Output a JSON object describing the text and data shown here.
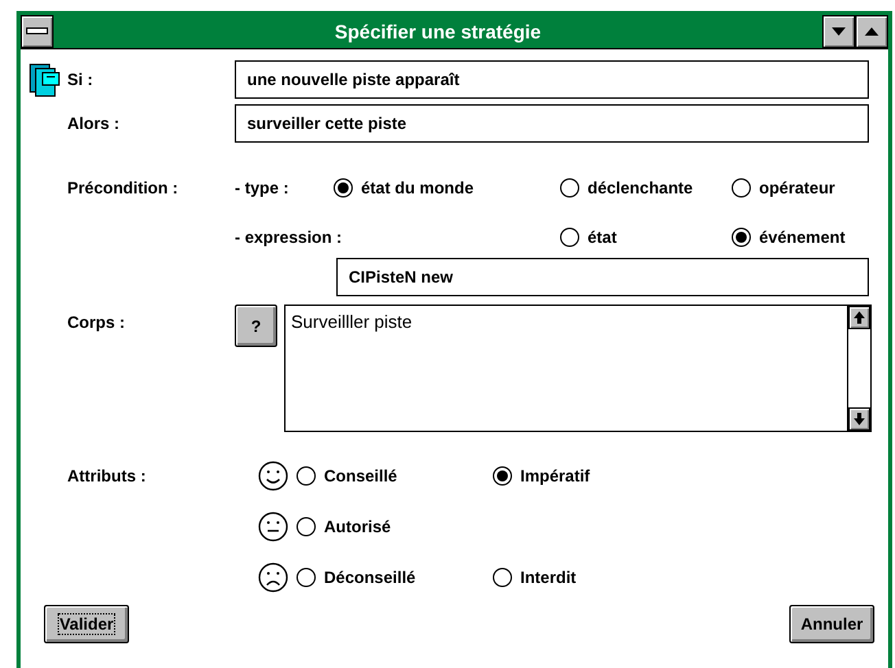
{
  "window": {
    "title": "Spécifier une stratégie"
  },
  "fields": [
    {
      "label": "Si :",
      "value": "une nouvelle piste apparaît"
    },
    {
      "label": "Alors :",
      "value": "surveiller cette piste"
    }
  ],
  "precondition": {
    "label": "Précondition :",
    "type": {
      "label": "- type :",
      "options": [
        {
          "label": "état du monde",
          "selected": true
        },
        {
          "label": "déclenchante",
          "selected": false
        },
        {
          "label": "opérateur",
          "selected": false
        }
      ]
    },
    "expression": {
      "label": "- expression :",
      "options": [
        {
          "label": "état",
          "selected": false
        },
        {
          "label": "événement",
          "selected": true
        }
      ],
      "value": "CIPisteN new"
    }
  },
  "corps": {
    "label": "Corps :",
    "help_button": "?",
    "text": "Surveilller piste"
  },
  "attributs": {
    "label": "Attributs :",
    "rows": [
      {
        "kind": "happy",
        "options": [
          {
            "label": "Conseillé",
            "selected": false
          },
          {
            "label": "Impératif",
            "selected": true
          }
        ]
      },
      {
        "kind": "neutral",
        "options": [
          {
            "label": "Autorisé",
            "selected": false
          }
        ]
      },
      {
        "kind": "sad",
        "options": [
          {
            "label": "Déconseillé",
            "selected": false
          },
          {
            "label": "Interdit",
            "selected": false
          }
        ]
      }
    ]
  },
  "buttons": [
    {
      "label": "Valider",
      "focused": true
    },
    {
      "label": "Annuler",
      "focused": false
    }
  ]
}
